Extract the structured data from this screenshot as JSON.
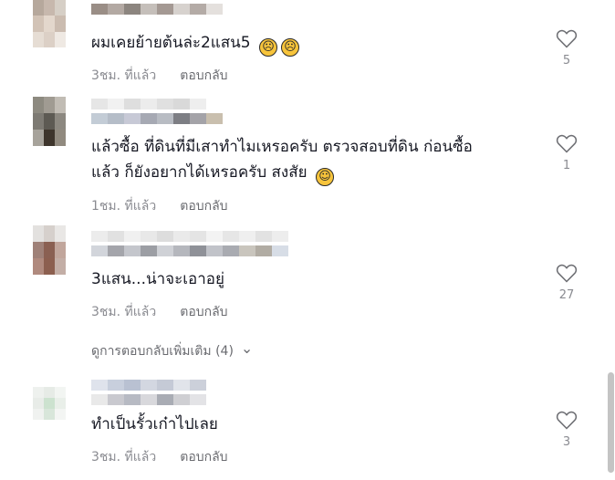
{
  "comments": [
    {
      "text": "ผมเคยย้ายต้นล่ะ2แสน5",
      "emoji_glyph": "☹",
      "emoji_glyph_2": "☹",
      "time": "3ชม. ที่แล้ว",
      "reply_label": "ตอบกลับ",
      "likes": "5"
    },
    {
      "text_line1": "แล้วซื้อ ที่ดินที่มีเสาทำไมเหรอครับ ตรวจสอบที่ดิน ก่อนซื้อ",
      "text_line2": "แล้ว ก็ยังอยากได้เหรอครับ สงสัย",
      "emoji_glyph": "☺",
      "time": "1ชม. ที่แล้ว",
      "reply_label": "ตอบกลับ",
      "likes": "1"
    },
    {
      "text": "3แสน...น่าจะเอาอยู่",
      "time": "3ชม. ที่แล้ว",
      "reply_label": "ตอบกลับ",
      "likes": "27"
    },
    {
      "text": "ทำเป็นรั้วเก๋าไปเลย",
      "time": "3ชม. ที่แล้ว",
      "reply_label": "ตอบกลับ",
      "likes": "3"
    }
  ],
  "more_replies": {
    "label": "ดูการตอบกลับเพิ่มเติม (4)",
    "chevron": "⌄"
  },
  "icons": {
    "like": "heart-outline-icon",
    "emoji_sad": "sad-face-emoji",
    "emoji_grin": "grinning-sweat-emoji"
  },
  "colors": {
    "text": "#161823",
    "meta": "#8a8b91",
    "reply": "#6a6b70"
  }
}
